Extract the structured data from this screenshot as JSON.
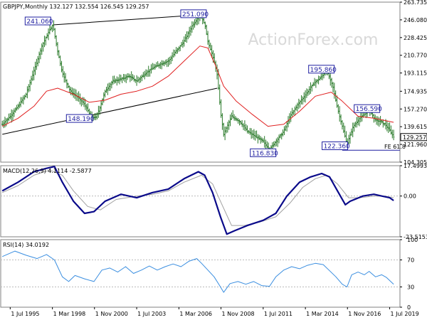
{
  "chart_data": [
    {
      "type": "line",
      "style": "bars",
      "symbol": "GBPJPY,Monthly",
      "ohlc": "132.127 132.554 126.545 129.257",
      "last_price": "129.257",
      "y_ticks": [
        "263.735",
        "246.080",
        "228.425",
        "210.770",
        "193.115",
        "174.935",
        "157.270",
        "139.615",
        "121.960",
        "104.305"
      ],
      "ylim": [
        104.305,
        263.735
      ],
      "x_ticks": [
        "1 Jul 1995",
        "1 Mar 1998",
        "1 Nov 2000",
        "1 Jul 2003",
        "1 Mar 2006",
        "1 Nov 2008",
        "1 Jul 2011",
        "1 Mar 2014",
        "1 Nov 2016",
        "1 Jul 2019"
      ],
      "x_tick_years": [
        1995.5,
        1998.17,
        2000.83,
        2003.5,
        2006.17,
        2008.83,
        2011.5,
        2014.17,
        2016.83,
        2019.5
      ],
      "price_path": [
        [
          1995.0,
          142
        ],
        [
          1995.5,
          150
        ],
        [
          1996.0,
          160
        ],
        [
          1996.5,
          172
        ],
        [
          1997.0,
          195
        ],
        [
          1997.5,
          220
        ],
        [
          1998.0,
          236
        ],
        [
          1998.2,
          241.06
        ],
        [
          1998.5,
          215
        ],
        [
          1998.8,
          193
        ],
        [
          1999.3,
          175
        ],
        [
          1999.7,
          170
        ],
        [
          2000.2,
          162
        ],
        [
          2000.6,
          150
        ],
        [
          2000.9,
          148.19
        ],
        [
          2001.2,
          160
        ],
        [
          2001.5,
          175
        ],
        [
          2002.0,
          185
        ],
        [
          2002.5,
          187
        ],
        [
          2003.0,
          190
        ],
        [
          2003.5,
          185
        ],
        [
          2004.0,
          192
        ],
        [
          2004.5,
          198
        ],
        [
          2005.0,
          202
        ],
        [
          2005.5,
          205
        ],
        [
          2006.0,
          215
        ],
        [
          2006.5,
          225
        ],
        [
          2007.0,
          240
        ],
        [
          2007.5,
          251.09
        ],
        [
          2007.8,
          242
        ],
        [
          2008.0,
          225
        ],
        [
          2008.4,
          205
        ],
        [
          2008.6,
          190
        ],
        [
          2008.8,
          155
        ],
        [
          2009.0,
          132
        ],
        [
          2009.5,
          150
        ],
        [
          2010.0,
          145
        ],
        [
          2010.5,
          135
        ],
        [
          2011.0,
          130
        ],
        [
          2011.5,
          125
        ],
        [
          2011.9,
          116.83
        ],
        [
          2012.3,
          125
        ],
        [
          2012.8,
          135
        ],
        [
          2013.2,
          150
        ],
        [
          2013.7,
          162
        ],
        [
          2014.2,
          172
        ],
        [
          2014.7,
          183
        ],
        [
          2015.1,
          188
        ],
        [
          2015.5,
          195.86
        ],
        [
          2015.9,
          180
        ],
        [
          2016.2,
          158
        ],
        [
          2016.5,
          140
        ],
        [
          2016.8,
          122.36
        ],
        [
          2017.2,
          140
        ],
        [
          2017.6,
          148
        ],
        [
          2017.9,
          152
        ],
        [
          2018.2,
          156.59
        ],
        [
          2018.6,
          146
        ],
        [
          2018.9,
          145
        ],
        [
          2019.2,
          142
        ],
        [
          2019.5,
          136
        ],
        [
          2019.75,
          129.257
        ]
      ],
      "ma_path": [
        [
          1995.0,
          140
        ],
        [
          1996.0,
          148
        ],
        [
          1997.0,
          160
        ],
        [
          1997.8,
          175
        ],
        [
          1998.5,
          178
        ],
        [
          1999.5,
          172
        ],
        [
          2000.5,
          164
        ],
        [
          2001.5,
          166
        ],
        [
          2002.5,
          172
        ],
        [
          2003.5,
          175
        ],
        [
          2004.5,
          180
        ],
        [
          2005.5,
          190
        ],
        [
          2006.5,
          205
        ],
        [
          2007.5,
          220
        ],
        [
          2008.0,
          218
        ],
        [
          2008.5,
          200
        ],
        [
          2009.0,
          180
        ],
        [
          2009.8,
          165
        ],
        [
          2010.8,
          152
        ],
        [
          2011.8,
          140
        ],
        [
          2012.8,
          142
        ],
        [
          2013.8,
          155
        ],
        [
          2014.8,
          170
        ],
        [
          2015.8,
          174
        ],
        [
          2016.5,
          165
        ],
        [
          2017.5,
          150
        ],
        [
          2018.5,
          148
        ],
        [
          2019.75,
          144
        ]
      ],
      "labels": [
        {
          "text": "241.060",
          "year": 1998.2,
          "price": 241.06
        },
        {
          "text": "251.090",
          "year": 2007.5,
          "price": 251.09
        },
        {
          "text": "148.190",
          "year": 2000.9,
          "price": 148.19
        },
        {
          "text": "195.860",
          "year": 2015.5,
          "price": 195.86
        },
        {
          "text": "156.590",
          "year": 2018.2,
          "price": 156.59
        },
        {
          "text": "116.830",
          "year": 2011.9,
          "price": 116.83
        },
        {
          "text": "122.360",
          "year": 2016.8,
          "price": 122.36
        }
      ],
      "fe_label": "FE 61.8",
      "fe_level": 116.2,
      "channel_upper": [
        [
          1998.2,
          241.06
        ],
        [
          2007.5,
          251.09
        ]
      ],
      "channel_lower": [
        [
          1995.0,
          132
        ],
        [
          2008.6,
          178
        ]
      ],
      "watermark": "ActionForex.com",
      "colors": {
        "price": "#2a7a2a",
        "ma": "#e02020",
        "channel": "#000000",
        "fe": "#1f1fa0"
      }
    },
    {
      "type": "line",
      "indicator": "MACD(12,26,9)",
      "title": "MACD(12,26,9) 4.1114 -2.5877",
      "y_ticks": [
        "17.4993",
        "0.00",
        "-23.5153"
      ],
      "ylim": [
        -23.5153,
        17.4993
      ],
      "macd_path": [
        [
          1995.0,
          3
        ],
        [
          1996.0,
          8
        ],
        [
          1997.0,
          14
        ],
        [
          1997.8,
          16
        ],
        [
          1998.3,
          17
        ],
        [
          1998.8,
          8
        ],
        [
          1999.5,
          -3
        ],
        [
          2000.2,
          -10
        ],
        [
          2000.8,
          -9
        ],
        [
          2001.5,
          -3
        ],
        [
          2002.5,
          1
        ],
        [
          2003.5,
          -1
        ],
        [
          2004.5,
          2
        ],
        [
          2005.5,
          4
        ],
        [
          2006.5,
          10
        ],
        [
          2007.4,
          14
        ],
        [
          2007.8,
          12
        ],
        [
          2008.3,
          2
        ],
        [
          2008.8,
          -12
        ],
        [
          2009.2,
          -22
        ],
        [
          2009.7,
          -20
        ],
        [
          2010.5,
          -17
        ],
        [
          2011.5,
          -14
        ],
        [
          2012.3,
          -10
        ],
        [
          2013.0,
          0
        ],
        [
          2013.8,
          8
        ],
        [
          2014.5,
          11
        ],
        [
          2015.2,
          13
        ],
        [
          2015.7,
          11
        ],
        [
          2016.2,
          3
        ],
        [
          2016.7,
          -5
        ],
        [
          2017.0,
          -3
        ],
        [
          2017.8,
          0
        ],
        [
          2018.5,
          1
        ],
        [
          2019.0,
          0
        ],
        [
          2019.5,
          -1
        ],
        [
          2019.75,
          -2.5877
        ]
      ],
      "signal_path": [
        [
          1995.0,
          2
        ],
        [
          1996.0,
          6
        ],
        [
          1997.0,
          12
        ],
        [
          1998.0,
          15
        ],
        [
          1998.8,
          12
        ],
        [
          1999.5,
          3
        ],
        [
          2000.4,
          -6
        ],
        [
          2001.2,
          -8
        ],
        [
          2002.2,
          -2
        ],
        [
          2003.5,
          0
        ],
        [
          2004.5,
          1
        ],
        [
          2005.5,
          3
        ],
        [
          2006.5,
          8
        ],
        [
          2007.6,
          12
        ],
        [
          2008.3,
          7
        ],
        [
          2008.9,
          -5
        ],
        [
          2009.5,
          -17
        ],
        [
          2010.3,
          -17
        ],
        [
          2011.3,
          -15
        ],
        [
          2012.3,
          -12
        ],
        [
          2013.2,
          -4
        ],
        [
          2014.0,
          5
        ],
        [
          2014.8,
          10
        ],
        [
          2015.5,
          12
        ],
        [
          2016.2,
          7
        ],
        [
          2016.9,
          -1
        ],
        [
          2017.6,
          -1
        ],
        [
          2018.5,
          0
        ],
        [
          2019.2,
          0
        ],
        [
          2019.75,
          -1
        ]
      ],
      "colors": {
        "macd": "#0a0a8a",
        "signal": "#a0a0a0",
        "zero": "#bbbbbb"
      }
    },
    {
      "type": "line",
      "indicator": "RSI(14)",
      "title": "RSI(14) 34.0192",
      "y_ticks": [
        "100",
        "70",
        "30",
        "0"
      ],
      "ylim": [
        0,
        100
      ],
      "levels": [
        70,
        30
      ],
      "rsi_path": [
        [
          1995.0,
          75
        ],
        [
          1995.8,
          83
        ],
        [
          1996.5,
          77
        ],
        [
          1997.2,
          72
        ],
        [
          1997.8,
          78
        ],
        [
          1998.3,
          70
        ],
        [
          1998.8,
          45
        ],
        [
          1999.2,
          38
        ],
        [
          1999.6,
          47
        ],
        [
          2000.2,
          42
        ],
        [
          2000.8,
          38
        ],
        [
          2001.3,
          55
        ],
        [
          2001.8,
          58
        ],
        [
          2002.3,
          52
        ],
        [
          2002.8,
          60
        ],
        [
          2003.3,
          50
        ],
        [
          2003.8,
          55
        ],
        [
          2004.3,
          61
        ],
        [
          2004.8,
          55
        ],
        [
          2005.3,
          60
        ],
        [
          2005.8,
          64
        ],
        [
          2006.3,
          60
        ],
        [
          2006.8,
          68
        ],
        [
          2007.3,
          72
        ],
        [
          2007.6,
          65
        ],
        [
          2008.0,
          55
        ],
        [
          2008.4,
          45
        ],
        [
          2008.8,
          30
        ],
        [
          2009.0,
          22
        ],
        [
          2009.4,
          35
        ],
        [
          2009.9,
          38
        ],
        [
          2010.4,
          34
        ],
        [
          2010.9,
          38
        ],
        [
          2011.4,
          32
        ],
        [
          2011.9,
          31
        ],
        [
          2012.3,
          45
        ],
        [
          2012.8,
          55
        ],
        [
          2013.3,
          60
        ],
        [
          2013.8,
          57
        ],
        [
          2014.3,
          62
        ],
        [
          2014.8,
          65
        ],
        [
          2015.3,
          63
        ],
        [
          2015.7,
          54
        ],
        [
          2016.1,
          45
        ],
        [
          2016.5,
          34
        ],
        [
          2016.8,
          30
        ],
        [
          2017.1,
          48
        ],
        [
          2017.5,
          52
        ],
        [
          2017.9,
          48
        ],
        [
          2018.2,
          53
        ],
        [
          2018.6,
          45
        ],
        [
          2019.0,
          48
        ],
        [
          2019.3,
          44
        ],
        [
          2019.75,
          34.0192
        ]
      ],
      "colors": {
        "rsi": "#3a8ee0",
        "level": "#bbbbbb"
      }
    }
  ]
}
